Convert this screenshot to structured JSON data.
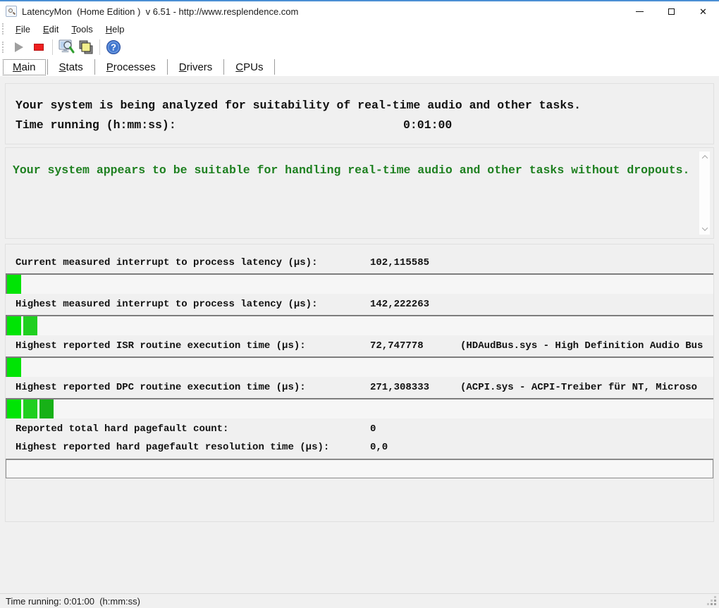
{
  "window": {
    "title": "LatencyMon  (Home Edition )  v 6.51 - http://www.resplendence.com"
  },
  "menu": {
    "items": [
      {
        "first": "F",
        "rest": "ile"
      },
      {
        "first": "E",
        "rest": "dit"
      },
      {
        "first": "T",
        "rest": "ools"
      },
      {
        "first": "H",
        "rest": "elp"
      }
    ]
  },
  "toolbar": {
    "icons": [
      "start-monitor-icon",
      "stop-monitor-icon",
      "analyze-icon",
      "copy-report-icon",
      "help-icon"
    ]
  },
  "tabs": [
    {
      "first": "M",
      "rest": "ain"
    },
    {
      "first": "S",
      "rest": "tats"
    },
    {
      "first": "P",
      "rest": "rocesses"
    },
    {
      "first": "D",
      "rest": "rivers"
    },
    {
      "first": "C",
      "rest": "PUs"
    }
  ],
  "analysis_panel": {
    "status_line": "Your system is being analyzed for suitability of real-time audio and other tasks.",
    "time_label": "Time running (h:mm:ss):",
    "time_value": "0:01:00"
  },
  "verdict_panel": {
    "message": "Your system appears to be suitable for handling real-time audio and other tasks without dropouts."
  },
  "measurements": {
    "rows": [
      {
        "label": "Current measured interrupt to process latency (µs):",
        "value": "102,115585",
        "driver": "",
        "segments": 1
      },
      {
        "label": "Highest measured interrupt to process latency (µs):",
        "value": "142,222263",
        "driver": "",
        "segments": 2
      },
      {
        "label": "Highest reported ISR routine execution time (µs):",
        "value": "72,747778",
        "driver": "(HDAudBus.sys - High Definition Audio Bus",
        "segments": 1
      },
      {
        "label": "Highest reported DPC routine execution time (µs):",
        "value": "271,308333",
        "driver": "(ACPI.sys - ACPI-Treiber für NT, Microso",
        "segments": 3
      }
    ],
    "pagefault_rows": [
      {
        "label": "Reported total hard pagefault count:",
        "value": "0"
      },
      {
        "label": "Highest reported hard pagefault resolution time (µs):",
        "value": "0,0"
      }
    ]
  },
  "statusbar": {
    "text": "Time running: 0:01:00  (h:mm:ss)"
  },
  "colors": {
    "verdict_green": "#1e8020",
    "bar_segments": [
      "#00e405",
      "#1fcf1f",
      "#17b117"
    ],
    "stop_red": "#ee1f1f"
  }
}
